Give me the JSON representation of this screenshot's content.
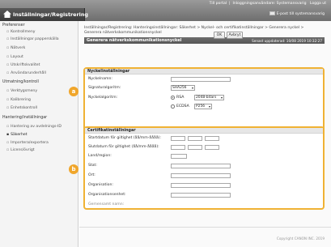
{
  "header": {
    "app_title": "Inställningar/Registrering",
    "portal_link": "Till portal",
    "user_info": "Inloggningsanvändare: Systemansvarig",
    "logout": "Logga ut",
    "mail_link": "E-post till systemansvarig"
  },
  "sidebar": {
    "group1": "Preferenser",
    "items1": [
      "Kontrollmeny",
      "Inställningar papperskälla",
      "Nätverk",
      "Layout",
      "Utskriftskvalitet",
      "Användarunderhåll"
    ],
    "group2": "Utmatning/kontroll",
    "items2": [
      "Verktygsmeny",
      "Kalibrering",
      "Enhetskontroll"
    ],
    "group3": "Hantering/inställningar",
    "items3": [
      "Hantering av avdelnings-ID",
      "Säkerhet",
      "Importera/exportera",
      "Licens/övrigt"
    ],
    "selected": "Säkerhet"
  },
  "breadcrumb": {
    "line1": "Inställningar/Registrering: Hanteringsinställningar: Säkerhet > Nyckel- och certifikatinställningar > Generera nyckel >",
    "line2": "Generera nätverkskommunikationsnyckel"
  },
  "page": {
    "title": "Generera nätverkskommunikationsnyckel",
    "last_updated": "Senast uppdaterad: 10/08 2019 10:32:27",
    "ok": "OK",
    "cancel": "Avbryt"
  },
  "key_section": {
    "title": "Nyckelinställningar",
    "key_name_label": "Nyckelnamn:",
    "key_name_value": "",
    "sig_label": "Signaturalgoritm:",
    "sig_value": "SHA256",
    "alg_label": "Nyckelalgoritm:",
    "rsa_label": "RSA",
    "rsa_value": "2048-bitars",
    "ecdsa_label": "ECDSA",
    "ecdsa_value": "P256",
    "selected_algorithm": "RSA"
  },
  "cert_section": {
    "title": "Certifikatinställningar",
    "start_label": "Startdatum för giltighet (åå/mm-åååå):",
    "end_label": "Slutdatum för giltighet (åå/mm-åååå):",
    "country_label": "Land/region:",
    "state_label": "Stat:",
    "city_label": "Ort:",
    "org_label": "Organisation:",
    "org_unit_label": "Organisationsenhet:",
    "common_name_label": "Gemensamt namn:"
  },
  "badges": {
    "a": "a",
    "b": "b"
  },
  "footer": {
    "copyright": "Copyright CANON INC. 2019"
  },
  "colors": {
    "highlight": "#f0b234",
    "badge": "#f0a62b",
    "header_bar": "#555555"
  }
}
